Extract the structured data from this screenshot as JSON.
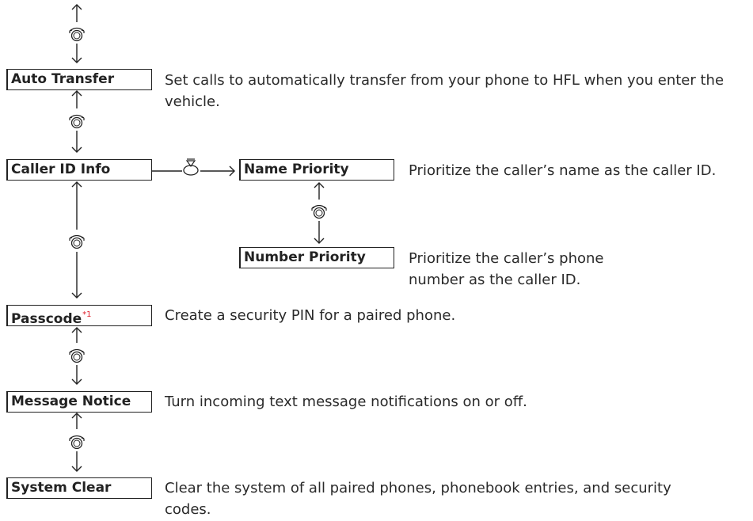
{
  "menu": {
    "auto_transfer": {
      "label": "Auto Transfer",
      "desc": "Set calls to automatically transfer from your phone to HFL when you enter the vehicle."
    },
    "caller_id": {
      "label": "Caller ID Info",
      "options": [
        {
          "label": "Name Priority",
          "desc": "Prioritize the caller’s name as the caller ID."
        },
        {
          "label": "Number Priority",
          "desc": "Prioritize the caller’s phone number as the caller ID."
        }
      ]
    },
    "passcode": {
      "label": "Passcode",
      "footnote": "*1",
      "desc": "Create a security PIN for a paired phone."
    },
    "message_notice": {
      "label": "Message Notice",
      "desc": "Turn incoming text message notifications on or off."
    },
    "system_clear": {
      "label": "System Clear",
      "desc": "Clear the system of all paired phones, phonebook entries, and security codes."
    }
  },
  "icons": {
    "rotate": "interface-dial-rotate-icon",
    "press": "interface-dial-press-icon"
  }
}
